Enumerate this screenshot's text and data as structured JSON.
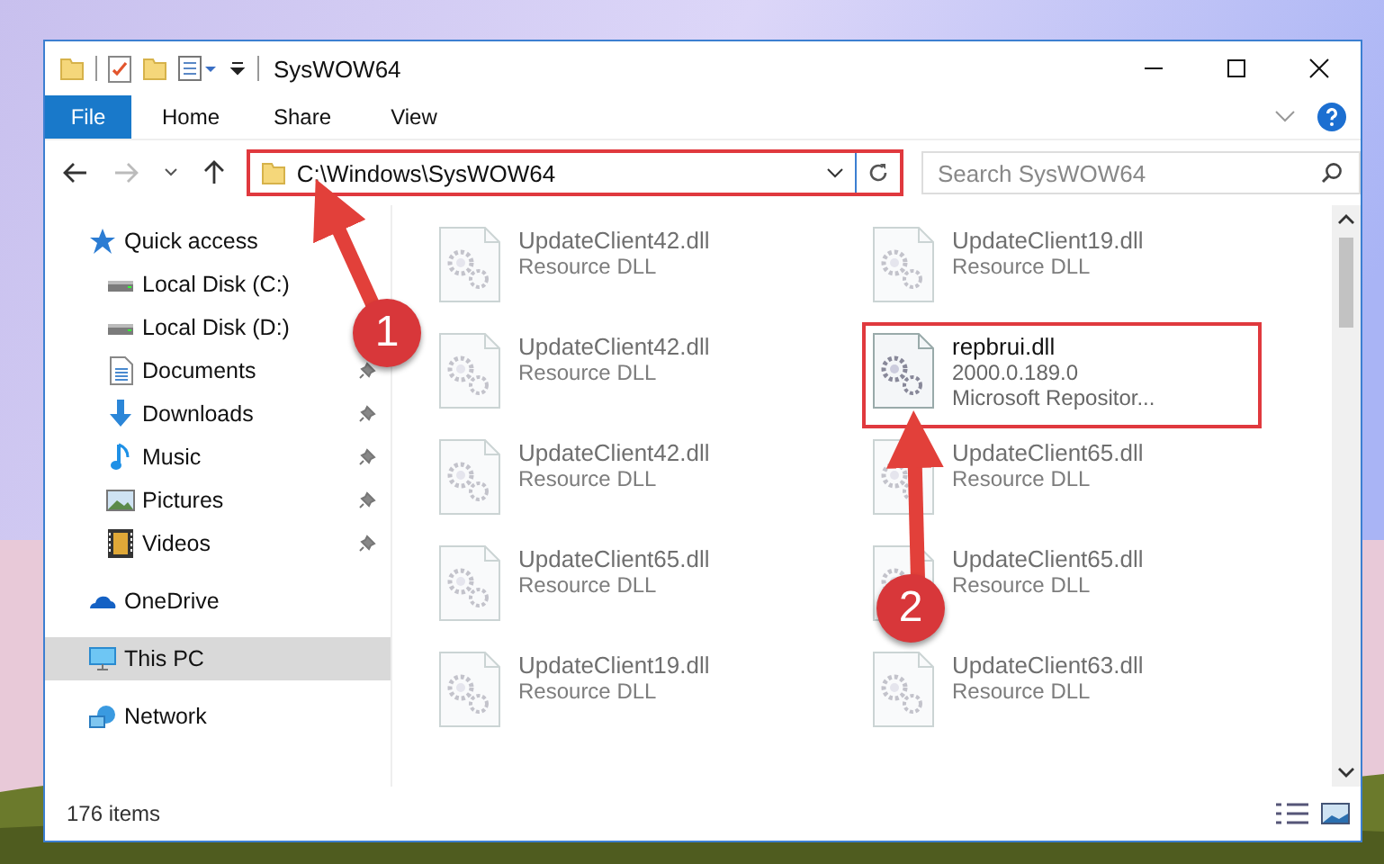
{
  "window": {
    "title": "SysWOW64"
  },
  "ribbon_tabs": [
    {
      "label": "File",
      "kind": "file"
    },
    {
      "label": "Home",
      "kind": "tab"
    },
    {
      "label": "Share",
      "kind": "tab"
    },
    {
      "label": "View",
      "kind": "tab"
    }
  ],
  "address_bar": {
    "path": "C:\\Windows\\SysWOW64",
    "highlighted": true
  },
  "search": {
    "placeholder": "Search SysWOW64"
  },
  "sidebar": {
    "items": [
      {
        "label": "Quick access",
        "kind": "star",
        "selected": false,
        "children": [
          {
            "label": "Local Disk (C:)",
            "kind": "drive",
            "pinned": false
          },
          {
            "label": "Local Disk (D:)",
            "kind": "drive",
            "pinned": false
          },
          {
            "label": "Documents",
            "kind": "document",
            "pinned": true
          },
          {
            "label": "Downloads",
            "kind": "download",
            "pinned": true
          },
          {
            "label": "Music",
            "kind": "music",
            "pinned": true
          },
          {
            "label": "Pictures",
            "kind": "pictures",
            "pinned": true
          },
          {
            "label": "Videos",
            "kind": "videos",
            "pinned": true
          }
        ]
      },
      {
        "label": "OneDrive",
        "kind": "cloud",
        "selected": false
      },
      {
        "label": "This PC",
        "kind": "pc",
        "selected": true
      },
      {
        "label": "Network",
        "kind": "network",
        "selected": false
      }
    ]
  },
  "files": [
    {
      "name": "UpdateClient42.dll",
      "details": [
        "Resource DLL"
      ],
      "dimmed": true,
      "highlighted": false
    },
    {
      "name": "UpdateClient19.dll",
      "details": [
        "Resource DLL"
      ],
      "dimmed": true,
      "highlighted": false
    },
    {
      "name": "UpdateClient42.dll",
      "details": [
        "Resource DLL"
      ],
      "dimmed": true,
      "highlighted": false
    },
    {
      "name": "repbrui.dll",
      "details": [
        "2000.0.189.0",
        "Microsoft Repositor..."
      ],
      "dimmed": false,
      "highlighted": true
    },
    {
      "name": "UpdateClient42.dll",
      "details": [
        "Resource DLL"
      ],
      "dimmed": true,
      "highlighted": false
    },
    {
      "name": "UpdateClient65.dll",
      "details": [
        "Resource DLL"
      ],
      "dimmed": true,
      "highlighted": false
    },
    {
      "name": "UpdateClient65.dll",
      "details": [
        "Resource DLL"
      ],
      "dimmed": true,
      "highlighted": false
    },
    {
      "name": "UpdateClient65.dll",
      "details": [
        "Resource DLL"
      ],
      "dimmed": true,
      "highlighted": false
    },
    {
      "name": "UpdateClient19.dll",
      "details": [
        "Resource DLL"
      ],
      "dimmed": true,
      "highlighted": false
    },
    {
      "name": "UpdateClient63.dll",
      "details": [
        "Resource DLL"
      ],
      "dimmed": true,
      "highlighted": false
    }
  ],
  "status_bar": {
    "item_count": "176 items"
  },
  "annotations": [
    {
      "label": "1"
    },
    {
      "label": "2"
    }
  ]
}
